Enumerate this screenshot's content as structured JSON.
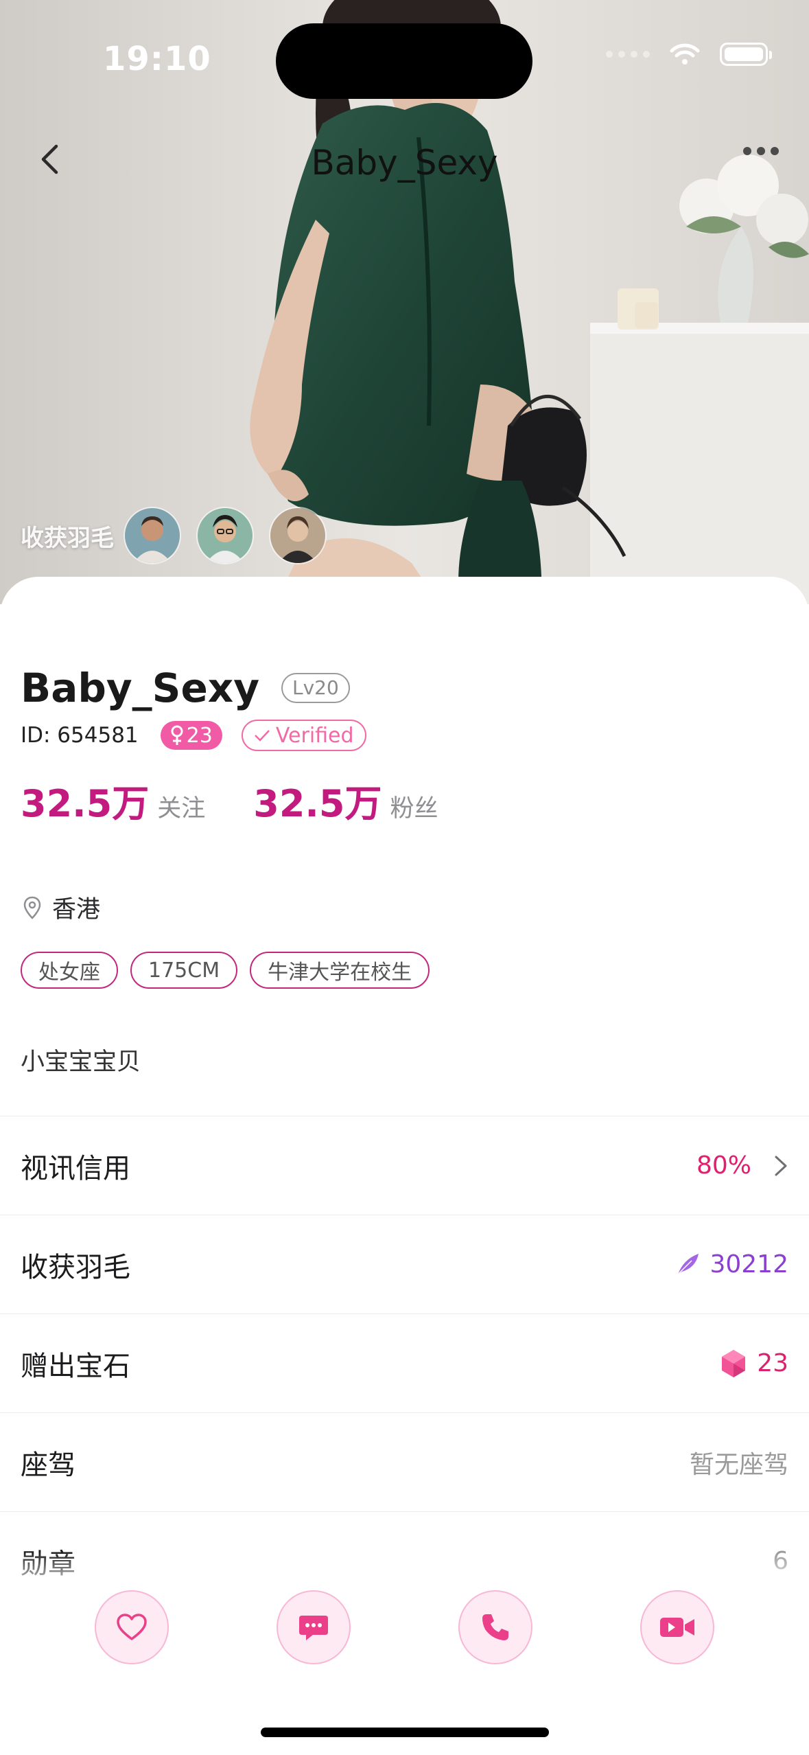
{
  "status_bar": {
    "time": "19:10"
  },
  "nav": {
    "title": "Baby_Sexy",
    "back_icon": "chevron-left-icon",
    "more_icon": "more-dots-icon"
  },
  "hero": {
    "feather_label": "收获羽毛"
  },
  "profile": {
    "name": "Baby_Sexy",
    "level": "Lv20",
    "id_text": "ID: 654581",
    "gender_age": "23",
    "verified": "Verified",
    "following_count": "32.5万",
    "following_label": "关注",
    "fans_count": "32.5万",
    "fans_label": "粉丝",
    "location": "香港",
    "tags": [
      "处女座",
      "175CM",
      "牛津大学在校生"
    ],
    "bio": "小宝宝宝贝"
  },
  "rows": [
    {
      "title": "视讯信用",
      "value": "80%",
      "value_color": "#e0206f"
    },
    {
      "title": "收获羽毛",
      "value": "30212",
      "value_color": "#8a3fd0"
    },
    {
      "title": "赠出宝石",
      "value": "23",
      "value_color": "#d8246f"
    },
    {
      "title": "座驾",
      "value": "暂无座驾",
      "value_color": "#9a9a9a"
    },
    {
      "title": "勋章",
      "value": "6",
      "value_color": "#9a9a9a"
    }
  ],
  "actions": [
    "heart-icon",
    "chat-icon",
    "phone-icon",
    "video-icon"
  ],
  "colors": {
    "accent": "#c21a7f",
    "pink": "#f15ba6"
  }
}
